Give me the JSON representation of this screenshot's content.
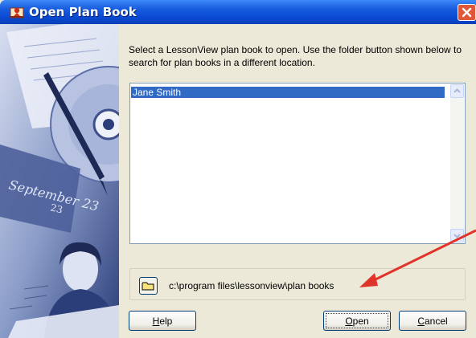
{
  "window": {
    "title": "Open Plan Book"
  },
  "instructions": "Select a LessonView plan book to open.  Use the folder button shown below to search for plan books in a different location.",
  "list": {
    "items": [
      "Jane Smith"
    ],
    "selected_index": 0
  },
  "sidebar_image": {
    "date_text": "September 23",
    "sub_text": "23"
  },
  "folder": {
    "path": "c:\\program files\\lessonview\\plan books"
  },
  "buttons": {
    "help": "Help",
    "open": "Open",
    "cancel": "Cancel"
  },
  "icons": {
    "title": "app-icon",
    "close": "close-icon",
    "folder": "folder-icon",
    "scroll_up": "chevron-up-icon",
    "scroll_down": "chevron-down-icon"
  },
  "colors": {
    "titlebar": "#0a4ad4",
    "selection": "#316ac5",
    "close": "#e0573a",
    "annotation_arrow": "#e0342a"
  }
}
